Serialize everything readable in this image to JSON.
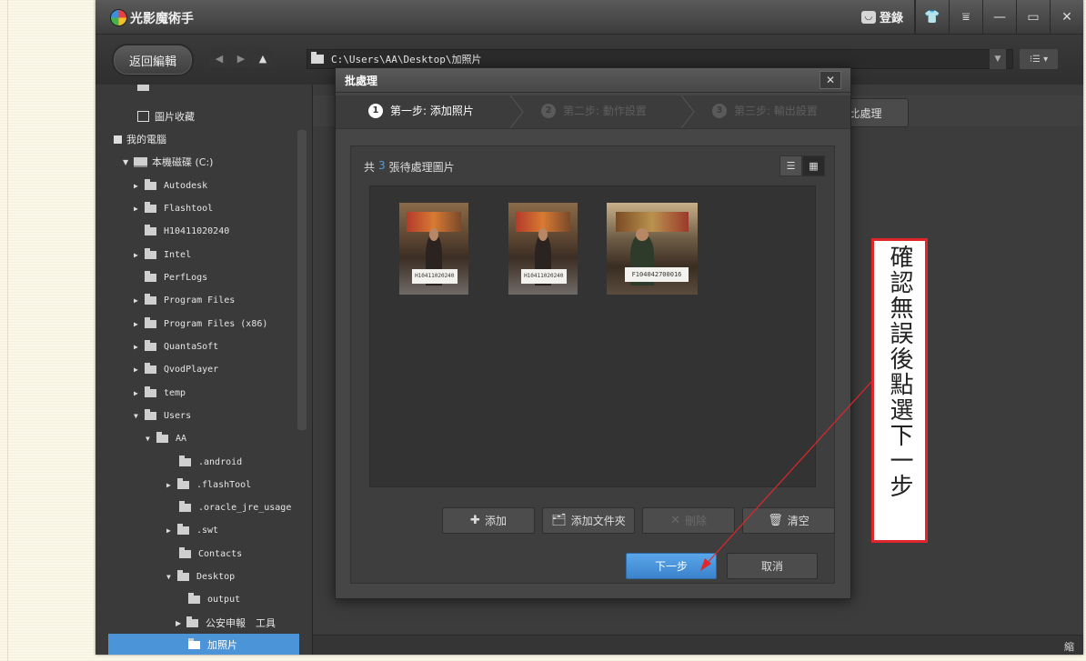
{
  "app": {
    "title": "光影魔術手",
    "login_label": "登錄",
    "window_buttons": [
      "shirt-icon",
      "menu-icon",
      "minimize-icon",
      "maximize-icon",
      "close-icon"
    ]
  },
  "toolbar": {
    "back_label": "返回編輯",
    "path": "C:\\Users\\AA\\Desktop\\加照片"
  },
  "sidebar": {
    "items": [
      {
        "label": "圖片收藏",
        "indent": 1
      },
      {
        "label": "我的電腦",
        "indent": 0
      },
      {
        "label": "本機磁碟 (C:)",
        "indent": 1
      },
      {
        "label": "Autodesk",
        "indent": 2
      },
      {
        "label": "Flashtool",
        "indent": 2
      },
      {
        "label": "H10411020240",
        "indent": 2
      },
      {
        "label": "Intel",
        "indent": 2
      },
      {
        "label": "PerfLogs",
        "indent": 2
      },
      {
        "label": "Program Files",
        "indent": 2
      },
      {
        "label": "Program Files (x86)",
        "indent": 2
      },
      {
        "label": "QuantaSoft",
        "indent": 2
      },
      {
        "label": "QvodPlayer",
        "indent": 2
      },
      {
        "label": "temp",
        "indent": 2
      },
      {
        "label": "Users",
        "indent": 2
      },
      {
        "label": "AA",
        "indent": 3
      },
      {
        "label": ".android",
        "indent": 4
      },
      {
        "label": ".flashTool",
        "indent": 4
      },
      {
        "label": ".oracle_jre_usage",
        "indent": 4
      },
      {
        "label": ".swt",
        "indent": 4
      },
      {
        "label": "Contacts",
        "indent": 4
      },
      {
        "label": "Desktop",
        "indent": 4
      },
      {
        "label": "output",
        "indent": 5
      },
      {
        "label": "公安申報　工具",
        "indent": 5
      },
      {
        "label": "加照片",
        "indent": 5
      }
    ]
  },
  "main": {
    "partial_button": "比處理",
    "zoom_label": "縮略圖"
  },
  "dialog": {
    "title": "批處理",
    "steps": [
      {
        "num": "1",
        "label": "第一步: 添加照片",
        "active": true
      },
      {
        "num": "2",
        "label": "第二步: 動作設置",
        "active": false
      },
      {
        "num": "3",
        "label": "第三步: 輸出設置",
        "active": false
      }
    ],
    "count_prefix": "共",
    "count": "3",
    "count_suffix": "張待處理圖片",
    "photos": [
      {
        "card_text": "H10411020240"
      },
      {
        "card_text": "H10411020240"
      },
      {
        "card_text": "F104042700016"
      }
    ],
    "buttons": {
      "add": "添加",
      "add_folder": "添加文件夾",
      "delete": "刪除",
      "clear": "清空",
      "next": "下一步",
      "cancel": "取消"
    }
  },
  "annotation": {
    "text": "確認無誤後點選下一步",
    "color": "#e0262a"
  }
}
